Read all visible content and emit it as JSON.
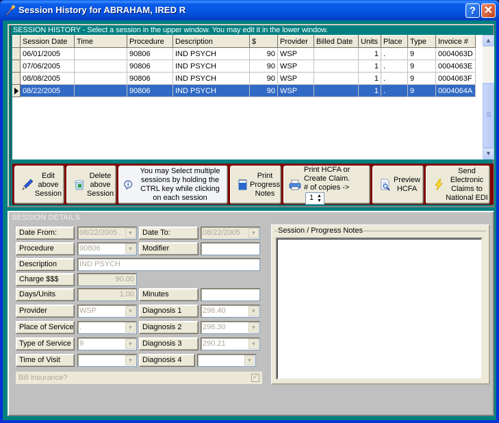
{
  "window": {
    "title": "Session History for ABRAHAM, IRED R",
    "help_label": "?",
    "close_label": "✕"
  },
  "history": {
    "heading": "SESSION HISTORY - Select a session in the upper window.  You may edit it in the lower window.",
    "columns": [
      "Session Date",
      "Time",
      "Procedure",
      "Description",
      "$",
      "Provider",
      "Billed Date",
      "Units",
      "Place",
      "Type",
      "Invoice #"
    ],
    "rows": [
      {
        "date": "06/01/2005",
        "time": "",
        "procedure": "90806",
        "description": "IND PSYCH",
        "amount": "90",
        "provider": "WSP",
        "billed": "",
        "units": "1",
        "place": ".",
        "type": "9",
        "invoice": "0004063D",
        "selected": false
      },
      {
        "date": "07/06/2005",
        "time": "",
        "procedure": "90806",
        "description": "IND PSYCH",
        "amount": "90",
        "provider": "WSP",
        "billed": "",
        "units": "1",
        "place": ".",
        "type": "9",
        "invoice": "0004063E",
        "selected": false
      },
      {
        "date": "08/08/2005",
        "time": "",
        "procedure": "90806",
        "description": "IND PSYCH",
        "amount": "90",
        "provider": "WSP",
        "billed": "",
        "units": "1",
        "place": ".",
        "type": "9",
        "invoice": "0004063F",
        "selected": false
      },
      {
        "date": "08/22/2005",
        "time": "",
        "procedure": "90806",
        "description": "IND PSYCH",
        "amount": "90",
        "provider": "WSP",
        "billed": "",
        "units": "1",
        "place": ".",
        "type": "9",
        "invoice": "0004064A",
        "selected": true
      }
    ]
  },
  "toolbar": {
    "edit_label": "Edit\nabove\nSession",
    "delete_label": "Delete\nabove\nSession",
    "info_text": "You may Select multiple\nsessions by holding the\nCTRL key while clicking\non each session",
    "print_notes_label": "Print\nProgress\nNotes",
    "print_hcfa_label": "Print HCFA or\nCreate Claim.\n# of copies ->",
    "copies_value": "1",
    "preview_label": "Preview\nHCFA",
    "send_label": "Send\nElectronic\nClaims to\nNational EDI"
  },
  "details": {
    "heading": "SESSION DETAILS",
    "date_from_label": "Date From:",
    "date_from_value": "08/22/2005",
    "date_to_label": "Date To:",
    "date_to_value": "08/22/2005",
    "procedure_label": "Procedure",
    "procedure_value": "90806",
    "modifier_label": "Modifier",
    "modifier_value": "",
    "description_label": "Description",
    "description_value": "IND PSYCH",
    "charge_label": "Charge $$$",
    "charge_value": "90.00",
    "units_label": "Days/Units",
    "units_value": "1.00",
    "minutes_label": "Minutes",
    "minutes_value": "",
    "provider_label": "Provider",
    "provider_value": "WSP",
    "diag1_label": "Diagnosis 1",
    "diag1_value": "296.40",
    "place_label": "Place of Service",
    "place_value": ".",
    "diag2_label": "Diagnosis 2",
    "diag2_value": "296.30",
    "type_label": "Type of Service",
    "type_value": "9",
    "diag3_label": "Diagnosis 3",
    "diag3_value": "290.21",
    "time_label": "Time of Visit",
    "time_value": "",
    "diag4_label": "Diagnosis 4",
    "diag4_value": "",
    "bill_insurance_label": "Bill insurance?",
    "bill_insurance_checked": true,
    "notes_legend": "Session / Progress Notes",
    "notes_value": ""
  }
}
